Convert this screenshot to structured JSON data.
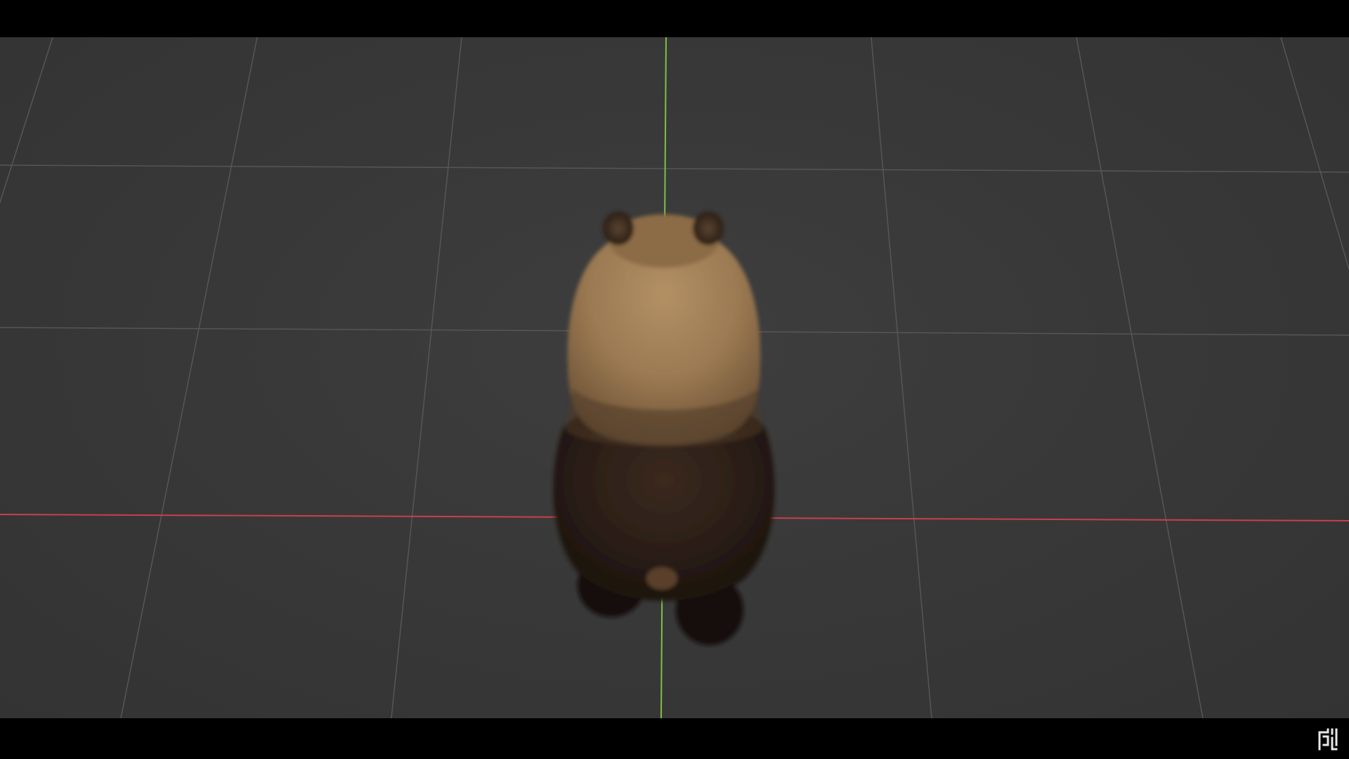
{
  "scene": {
    "background_color": "#363636",
    "grid_color": "#575757",
    "x_axis_color": "#c8404c",
    "y_axis_color": "#7fc040",
    "subject": "bear-model-top-view"
  },
  "watermark": {
    "icon": "channel-logo-icon"
  }
}
